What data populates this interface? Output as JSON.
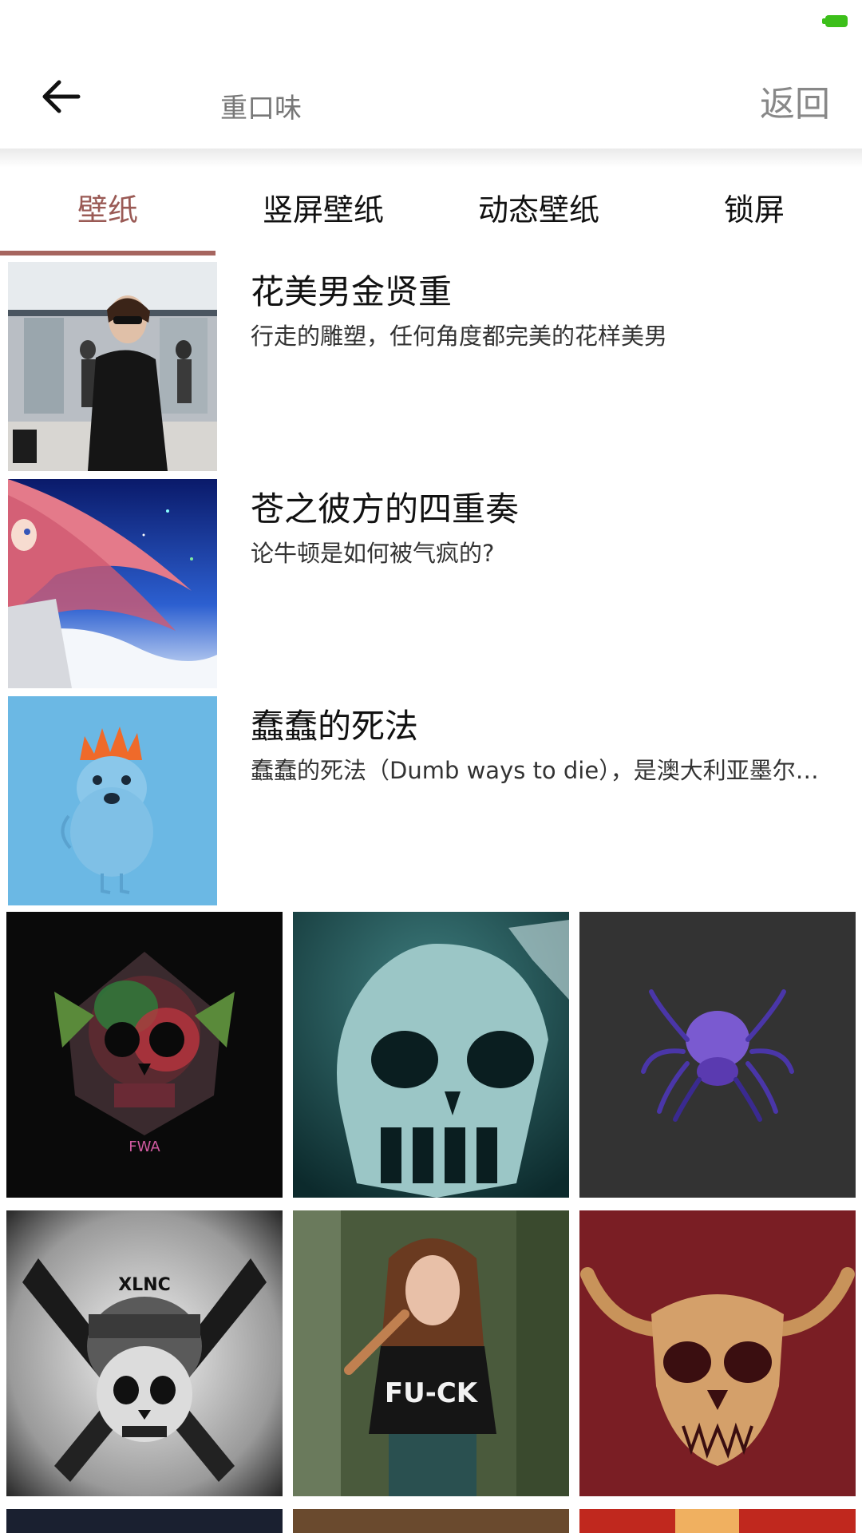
{
  "header": {
    "search_text": "重口味",
    "return_label": "返回"
  },
  "tabs": [
    {
      "label": "壁纸",
      "active": true
    },
    {
      "label": "竖屏壁纸",
      "active": false
    },
    {
      "label": "动态壁纸",
      "active": false
    },
    {
      "label": "锁屏",
      "active": false
    }
  ],
  "list": [
    {
      "title": "花美男金贤重",
      "subtitle": "行走的雕塑，任何角度都完美的花样美男"
    },
    {
      "title": "苍之彼方的四重奏",
      "subtitle": "论牛顿是如何被气疯的?"
    },
    {
      "title": "蠢蠢的死法",
      "subtitle": "蠢蠢的死法（Dumb ways to die），是澳大利亚墨尔…"
    }
  ],
  "grid": {
    "fwa_text": "FWA",
    "xlnc_text": "XLNC",
    "shirt_text": "FU-CK"
  },
  "colors": {
    "accent": "#a6655f",
    "battery": "#3cbf1a"
  }
}
